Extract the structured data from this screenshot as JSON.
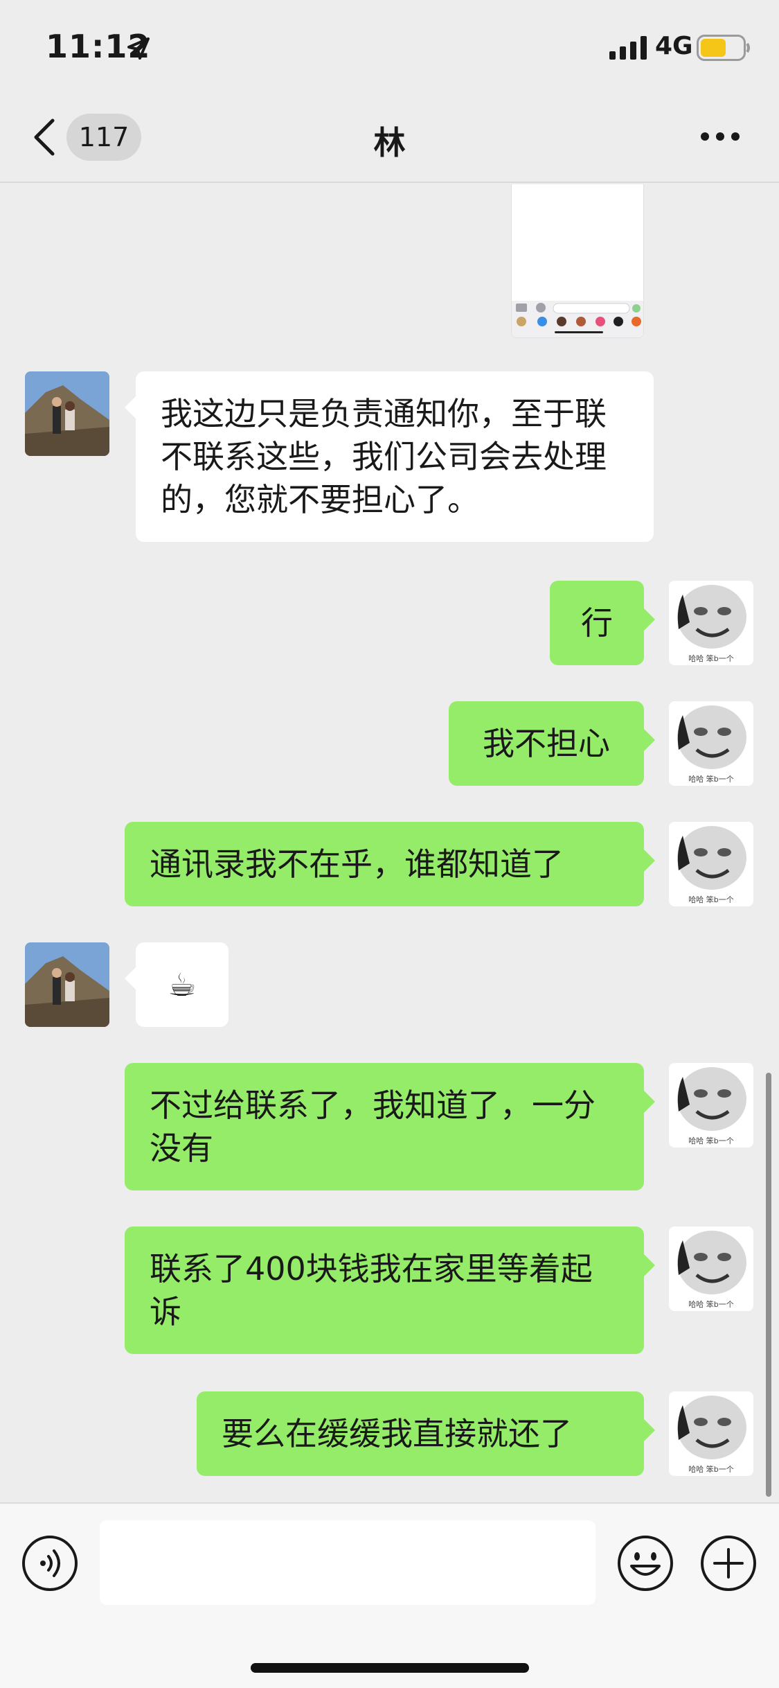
{
  "status_bar": {
    "time": "11:12",
    "network": "4G",
    "battery_color": "#f5c518"
  },
  "nav": {
    "unread_count": "117",
    "title": "林"
  },
  "avatars": {
    "contact": "contact-photo",
    "me": "meme-face",
    "me_caption": "哈哈 笨b一个"
  },
  "messages": [
    {
      "direction": "in",
      "text": "我这边只是负责通知你，至于联不联系这些，我们公司会去处理的，您就不要担心了。"
    },
    {
      "direction": "out",
      "text": "行"
    },
    {
      "direction": "out",
      "text": "我不担心"
    },
    {
      "direction": "out",
      "text": "通讯录我不在乎，谁都知道了"
    },
    {
      "direction": "in",
      "text": "☕"
    },
    {
      "direction": "out",
      "text": "不过给联系了，我知道了，一分没有"
    },
    {
      "direction": "out",
      "text": "联系了400块钱我在家里等着起诉"
    },
    {
      "direction": "out",
      "text": "要么在缓缓我直接就还了"
    }
  ],
  "input": {
    "placeholder": ""
  },
  "colors": {
    "outgoing_bubble": "#95ec69",
    "incoming_bubble": "#ffffff",
    "background": "#ededed"
  }
}
